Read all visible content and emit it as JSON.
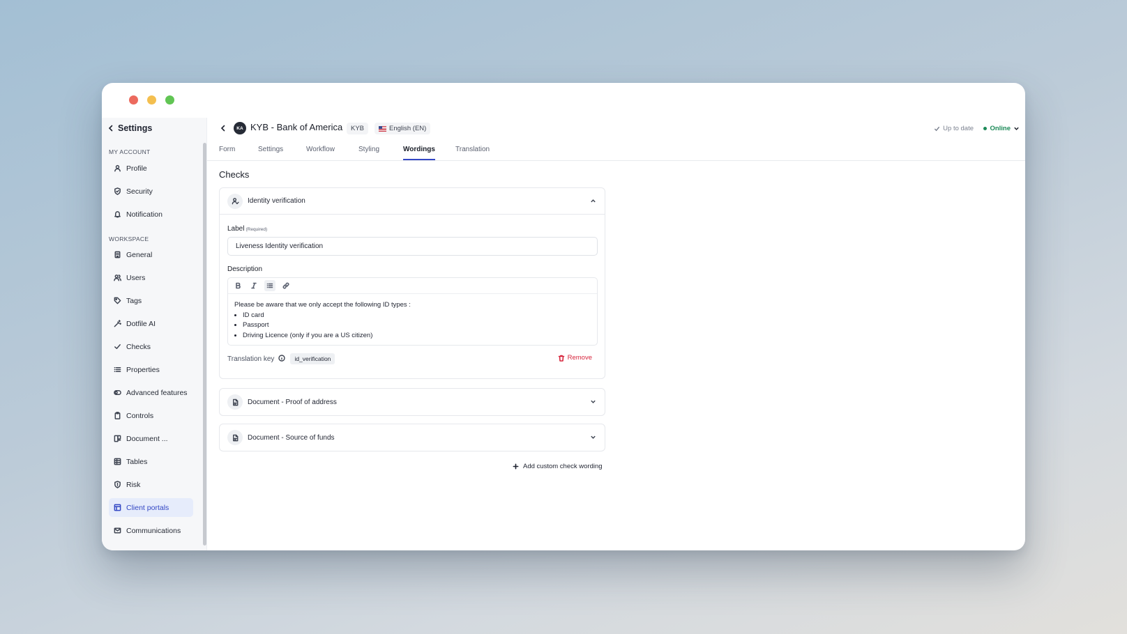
{
  "sidebar": {
    "back_label": "Settings",
    "sections": {
      "account": "MY ACCOUNT",
      "workspace": "WORKSPACE"
    },
    "items": [
      {
        "label": "Profile",
        "icon": "user-icon"
      },
      {
        "label": "Security",
        "icon": "shield-icon"
      },
      {
        "label": "Notification",
        "icon": "bell-icon"
      },
      {
        "label": "General",
        "icon": "building-icon"
      },
      {
        "label": "Users",
        "icon": "users-icon"
      },
      {
        "label": "Tags",
        "icon": "tag-icon"
      },
      {
        "label": "Dotfile AI",
        "icon": "wand-icon"
      },
      {
        "label": "Checks",
        "icon": "check-icon"
      },
      {
        "label": "Properties",
        "icon": "list-icon"
      },
      {
        "label": "Advanced features",
        "icon": "toggle-icon"
      },
      {
        "label": "Controls",
        "icon": "clipboard-icon"
      },
      {
        "label": "Document ...",
        "icon": "document-icon"
      },
      {
        "label": "Tables",
        "icon": "table-icon"
      },
      {
        "label": "Risk",
        "icon": "shield-alert-icon"
      },
      {
        "label": "Client portals",
        "icon": "layout-icon",
        "active": true
      },
      {
        "label": "Communications",
        "icon": "mail-icon"
      }
    ]
  },
  "header": {
    "avatar": "KA",
    "title": "KYB - Bank of America",
    "type_badge": "KYB",
    "language": "English (EN)",
    "sync_status": "Up to date",
    "online_status": "Online"
  },
  "tabs": [
    "Form",
    "Settings",
    "Workflow",
    "Styling",
    "Wordings",
    "Translation"
  ],
  "active_tab": "Wordings",
  "main": {
    "title": "Checks",
    "identity": {
      "title": "Identity verification",
      "label_title": "Label",
      "label_required": "(Required)",
      "label_value": "Liveness Identity verification",
      "description_title": "Description",
      "description_intro": "Please be aware that we only accept the following ID types :",
      "description_items": [
        "ID card",
        "Passport",
        "Driving Licence (only if you are a US citizen)"
      ],
      "translation_key_label": "Translation key",
      "translation_key_value": "id_verification",
      "remove_label": "Remove"
    },
    "proof_of_address": {
      "title": "Document - Proof of address"
    },
    "source_of_funds": {
      "title": "Document - Source of funds"
    },
    "add_custom_label": "Add custom check wording"
  },
  "colors": {
    "accent": "#3347c4",
    "online": "#1c8a58",
    "danger": "#d7263d"
  }
}
